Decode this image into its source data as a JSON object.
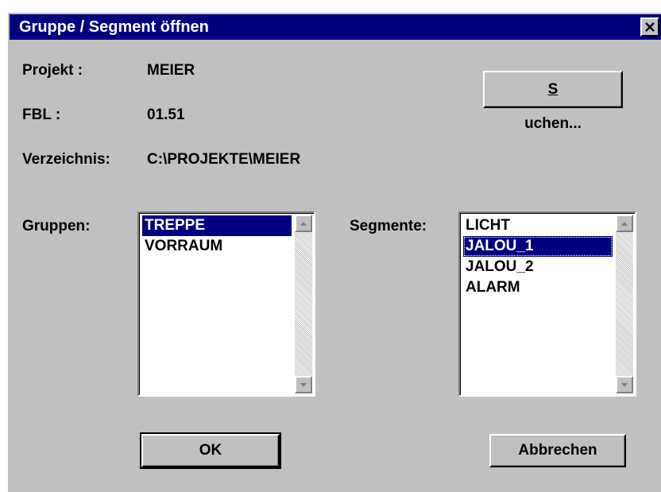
{
  "window": {
    "title": "Gruppe / Segment öffnen"
  },
  "info": {
    "project_label": "Projekt :",
    "project_value": "MEIER",
    "fbl_label": "FBL :",
    "fbl_value": "01.51",
    "dir_label": "Verzeichnis:",
    "dir_value": "C:\\PROJEKTE\\MEIER"
  },
  "buttons": {
    "search_underlined": "S",
    "search_rest": "uchen...",
    "ok": "OK",
    "cancel": "Abbrechen"
  },
  "groups": {
    "label": "Gruppen:",
    "items": [
      "TREPPE",
      "VORRAUM"
    ],
    "selected": "TREPPE"
  },
  "segments": {
    "label": "Segmente:",
    "items": [
      "LICHT",
      "JALOU_1",
      "JALOU_2",
      "ALARM"
    ],
    "selected": "JALOU_1"
  },
  "colors": {
    "titlebar": "#000080",
    "face": "#c0c0c0",
    "selection": "#000080"
  },
  "icons": {
    "close": "close-icon",
    "scroll_up": "arrow-up-icon",
    "scroll_down": "arrow-down-icon"
  }
}
